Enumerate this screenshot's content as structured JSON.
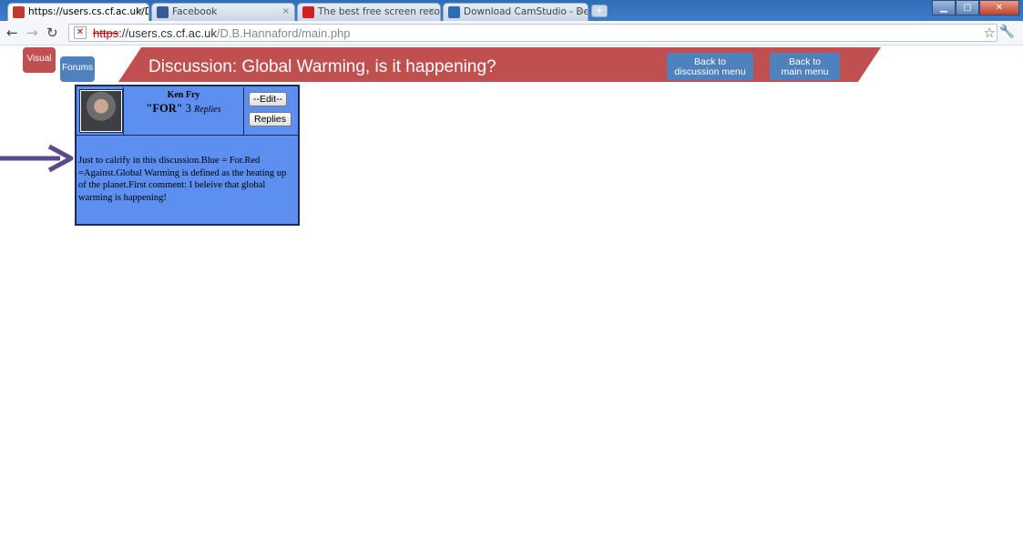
{
  "browser": {
    "tabs": [
      {
        "label": "https://users.cs.cf.ac.uk/D.E",
        "active": true
      },
      {
        "label": "Facebook",
        "active": false
      },
      {
        "label": "The best free screen recorde",
        "active": false
      },
      {
        "label": "Download CamStudio - Dea",
        "active": false
      }
    ],
    "url_scheme": "https",
    "url_host": "://users.cs.cf.ac.uk",
    "url_path": "/D.B.Hannaford/main.php"
  },
  "page": {
    "title": "Discussion: Global Warming, is it happening?",
    "visual_label": "Visual",
    "forums_label": "Forums",
    "back_discussion_line1": "Back to",
    "back_discussion_line2": "discussion menu",
    "back_main_line1": "Back to",
    "back_main_line2": "main menu"
  },
  "post": {
    "author": "Ken Fry",
    "stance": "\"FOR\"",
    "reply_count": "3",
    "replies_word": "Replies",
    "edit_label": "--Edit--",
    "replies_button": "Replies",
    "body": "Just to calrify in this discussion.Blue = For.Red =Against.Global Warming is defined as the heating up of the planet.First comment: I beleive that global warming is happening!"
  },
  "colors": {
    "banner": "#c0504f",
    "accent_blue": "#4f81bd",
    "card_blue": "#5c8ff0"
  }
}
